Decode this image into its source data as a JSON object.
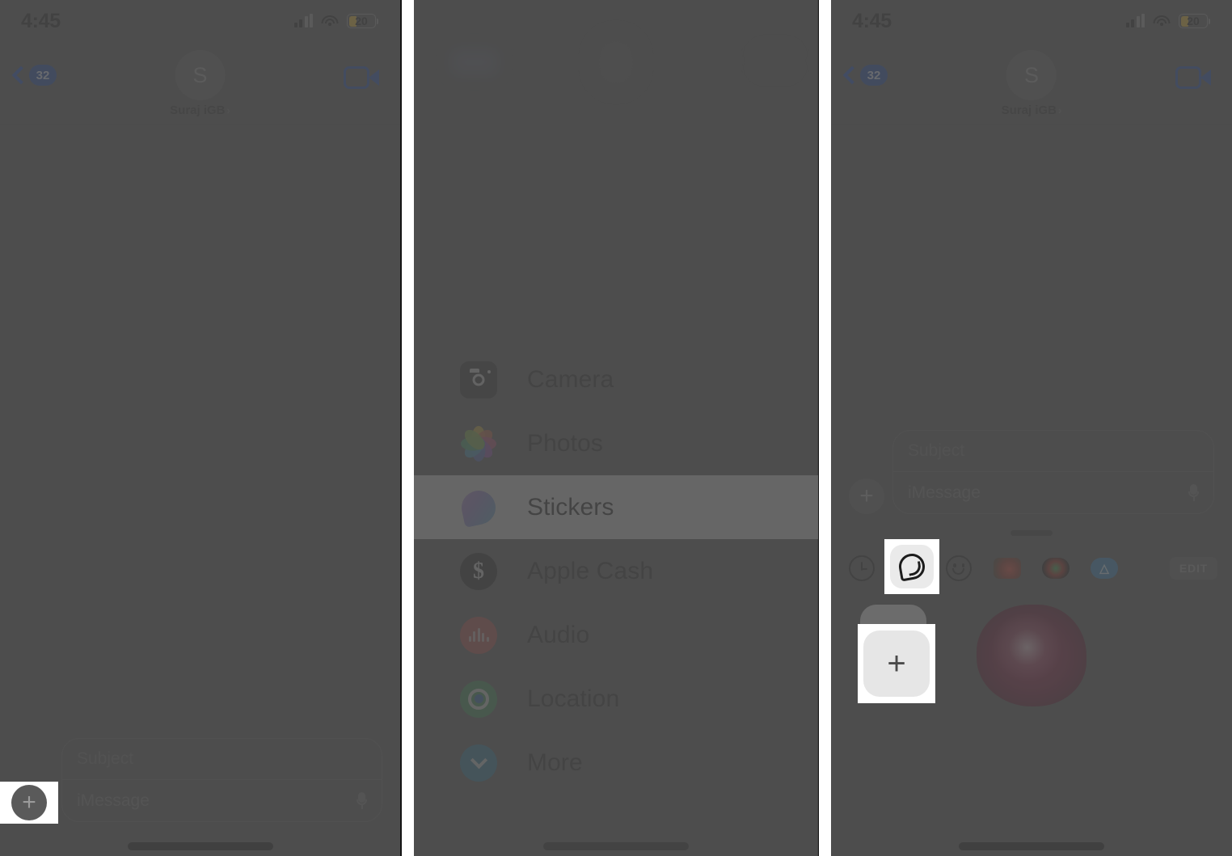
{
  "meta": {
    "accent_blue": "#1b46a8",
    "overlay_gray": "#4d4d4d",
    "highlight_white": "#ffffff"
  },
  "status_bar": {
    "time": "4:45",
    "battery_level": "20",
    "cell_icon": "cellular-bars-icon",
    "wifi_icon": "wifi-icon",
    "battery_icon": "battery-icon"
  },
  "nav_bar": {
    "back_badge": "32",
    "back_icon": "chevron-left-icon",
    "avatar_initial": "S",
    "contact_name": "Suraj iGB",
    "contact_chevron": "›",
    "facetime_icon": "video-camera-icon"
  },
  "compose": {
    "plus_label": "+",
    "plus_icon": "plus-icon",
    "subject_placeholder": "Subject",
    "message_placeholder": "iMessage",
    "mic_icon": "microphone-icon"
  },
  "attachment_menu": {
    "items": [
      {
        "label": "Camera",
        "icon": "camera-icon",
        "selected": false
      },
      {
        "label": "Photos",
        "icon": "photos-icon",
        "selected": false
      },
      {
        "label": "Stickers",
        "icon": "stickers-icon",
        "selected": true
      },
      {
        "label": "Apple Cash",
        "icon": "apple-cash-icon",
        "selected": false
      },
      {
        "label": "Audio",
        "icon": "audio-icon",
        "selected": false
      },
      {
        "label": "Location",
        "icon": "location-icon",
        "selected": false
      },
      {
        "label": "More",
        "icon": "more-chevron-icon",
        "selected": false
      }
    ]
  },
  "sticker_drawer": {
    "grabber_icon": "drag-handle-icon",
    "tabs": [
      {
        "icon": "recents-clock-icon",
        "selected": false
      },
      {
        "icon": "stickers-peel-icon",
        "selected": true
      },
      {
        "icon": "emoji-smiley-icon",
        "selected": false
      },
      {
        "icon": "sticker-pack-rose-icon",
        "selected": false
      },
      {
        "icon": "sticker-pack-dark-icon",
        "selected": false
      },
      {
        "icon": "sticker-pack-blue-icon",
        "selected": false
      }
    ],
    "edit_label": "EDIT",
    "add_sticker_label": "+",
    "add_sticker_icon": "add-sticker-icon",
    "stickers": [
      {
        "name": "rose-sticker",
        "color": "#6d1030"
      }
    ]
  },
  "panels": [
    {
      "id": "panel-1",
      "highlight": "compose-plus-button"
    },
    {
      "id": "panel-2",
      "highlight": "stickers-menu-row"
    },
    {
      "id": "panel-3",
      "highlight": "stickers-tab-and-add-button"
    }
  ]
}
